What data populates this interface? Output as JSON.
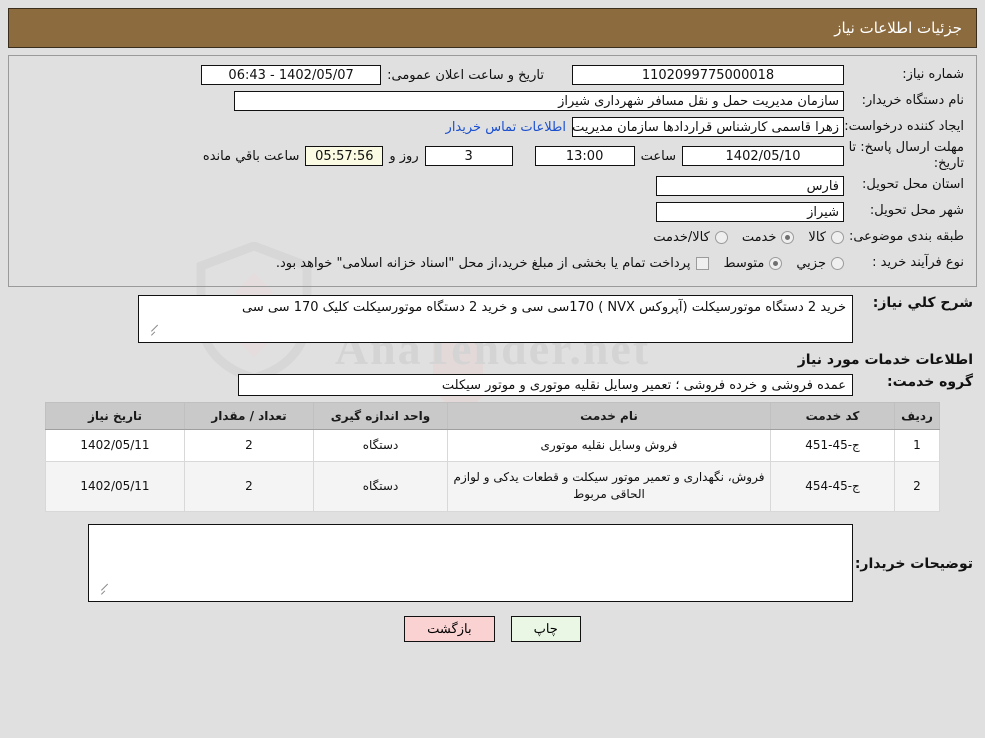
{
  "header": {
    "title": "جزئیات اطلاعات نیاز"
  },
  "info": {
    "need_number_label": "شماره نیاز:",
    "need_number_value": "1102099775000018",
    "announce_label": "تاریخ و ساعت اعلان عمومی:",
    "announce_value": "1402/05/07 - 06:43",
    "buyer_org_label": "نام دستگاه خریدار:",
    "buyer_org_value": "سازمان مدیریت حمل و نقل مسافر شهرداری شیراز",
    "creator_label": "ایجاد کننده درخواست:",
    "creator_value": "زهرا قاسمی کارشناس قراردادها سازمان مدیریت حمل و نقل مسافر شهرداری ش",
    "contact_link": "اطلاعات تماس خریدار",
    "deadline_label": "مهلت ارسال پاسخ: تا تاریخ:",
    "deadline_date": "1402/05/10",
    "hour_label": "ساعت",
    "deadline_time": "13:00",
    "days_value": "3",
    "days_label": "روز و",
    "countdown_value": "05:57:56",
    "countdown_label": "ساعت باقي مانده",
    "province_label": "استان محل تحویل:",
    "province_value": "فارس",
    "city_label": "شهر محل تحویل:",
    "city_value": "شیراز",
    "category_label": "طبقه بندی موضوعی:",
    "category_options": [
      {
        "label": "کالا",
        "selected": false
      },
      {
        "label": "خدمت",
        "selected": true
      },
      {
        "label": "کالا/خدمت",
        "selected": false
      }
    ],
    "process_label": "نوع فرآیند خرید :",
    "process_options": [
      {
        "label": "جزیي",
        "selected": false
      },
      {
        "label": "متوسط",
        "selected": true
      }
    ],
    "treasury_checkbox_checked": false,
    "treasury_text": "پرداخت تمام یا بخشی از مبلغ خرید،از محل \"اسناد خزانه اسلامی\" خواهد بود."
  },
  "description": {
    "label": "شرح کلي نیاز:",
    "value": "خرید 2 دستگاه موتورسیکلت (آپروکس NVX ) 170سی سی و خرید 2 دستگاه موتورسیکلت کلیک 170 سی سی"
  },
  "services_section": {
    "heading": "اطلاعات خدمات مورد نیاز",
    "group_label": "گروه خدمت:",
    "group_value": "عمده فروشی و خرده فروشی ؛ تعمیر وسایل نقلیه موتوری و موتور سیکلت"
  },
  "table": {
    "columns": [
      "ردیف",
      "کد خدمت",
      "نام خدمت",
      "واحد اندازه گیری",
      "تعداد / مقدار",
      "تاریخ نیاز"
    ],
    "rows": [
      {
        "index": "1",
        "code": "ج-45-451",
        "name": "فروش وسایل نقلیه موتوری",
        "unit": "دستگاه",
        "qty": "2",
        "date": "1402/05/11"
      },
      {
        "index": "2",
        "code": "ج-45-454",
        "name": "فروش، نگهداری و تعمیر موتور سیکلت و قطعات یدکی و لوازم الحاقی مربوط",
        "unit": "دستگاه",
        "qty": "2",
        "date": "1402/05/11"
      }
    ]
  },
  "buyer_notes": {
    "label": "توضیحات خریدار:",
    "value": ""
  },
  "buttons": {
    "back": "بازگشت",
    "print": "چاپ"
  },
  "watermark": {
    "text": "AnaTender.net"
  },
  "colors": {
    "header_bar": "#8c6b3f",
    "page_bg": "#e0e0e0",
    "link": "#1a4fcf",
    "back_button": "#fbd2d2",
    "print_button": "#e9f7e4",
    "countdown_bg": "#fbfbe3",
    "table_header": "#c9c9c9"
  }
}
